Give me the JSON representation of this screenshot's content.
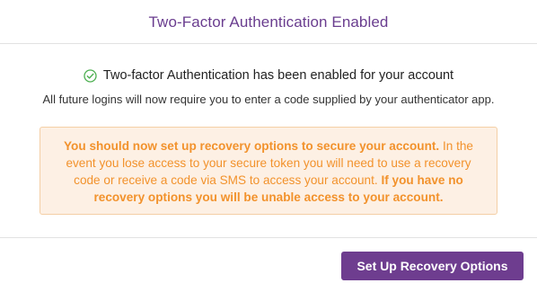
{
  "modal": {
    "title": "Two-Factor Authentication Enabled"
  },
  "body": {
    "success_icon": "check-circle-icon",
    "success_text": "Two-factor Authentication has been enabled for your account",
    "subline": "All future logins will now require you to enter a code supplied by your authenticator app."
  },
  "warning": {
    "line1_bold": "You should now set up recovery options to secure your account.",
    "text_normal": "In the event you lose access to your secure token you will need to use a recovery code or receive a code via SMS to access your account.",
    "text_bold_tail": "If you have no recovery options you will be unable access to your account."
  },
  "footer": {
    "setup_button_label": "Set Up Recovery Options"
  },
  "colors": {
    "brand_purple": "#6e3d8f",
    "title_purple": "#6a3d8f",
    "warning_text": "#f2922c",
    "warning_bg": "#fdf0e4",
    "warning_border": "#f4cfa6",
    "success_green": "#4caf50"
  }
}
